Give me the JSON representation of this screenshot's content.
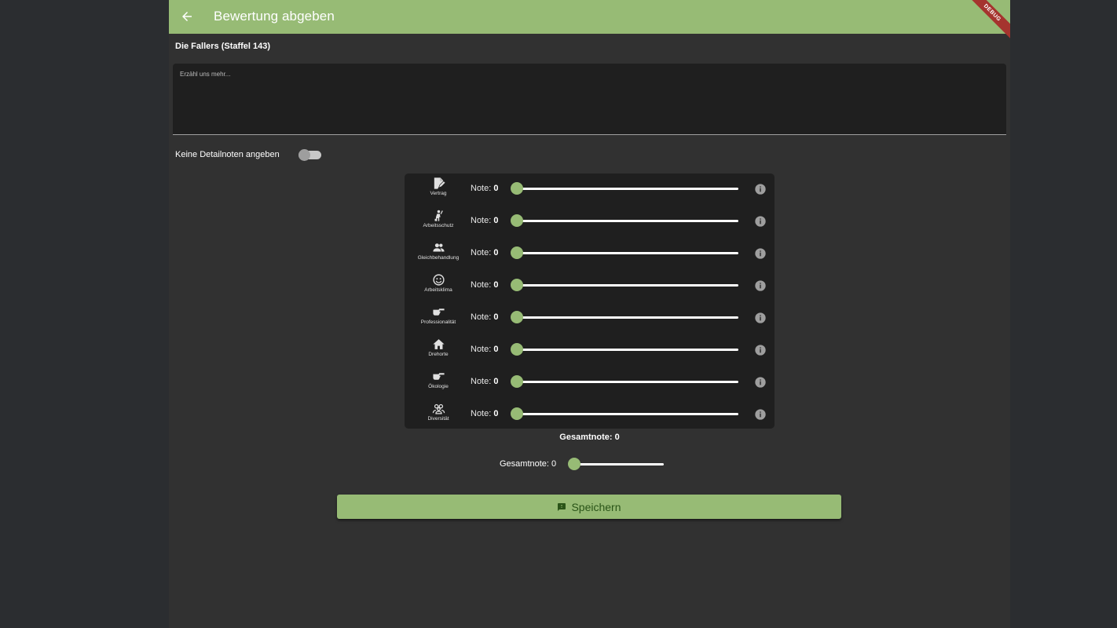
{
  "appbar": {
    "title": "Bewertung abgeben",
    "debug_label": "DEBUG",
    "back_icon": "arrow-back-icon"
  },
  "show_title": "Die Fallers (Staffel 143)",
  "review_input": {
    "placeholder": "Erzähl uns mehr...",
    "value": ""
  },
  "toggle": {
    "label": "Keine Detailnoten angeben",
    "on": false
  },
  "ratings": {
    "note_label": "Note: ",
    "items": [
      {
        "label": "Vertrag",
        "icon": "contract-icon",
        "value": "0"
      },
      {
        "label": "Arbeitsschutz",
        "icon": "worker-icon",
        "value": "0"
      },
      {
        "label": "Gleichbehandlung",
        "icon": "people-icon",
        "value": "0"
      },
      {
        "label": "Arbeitsklima",
        "icon": "smiley-icon",
        "value": "0"
      },
      {
        "label": "Professionalität",
        "icon": "hand-pointing-icon",
        "value": "0"
      },
      {
        "label": "Drehorte",
        "icon": "home-icon",
        "value": "0"
      },
      {
        "label": "Ökologie",
        "icon": "hand-pointing-icon",
        "value": "0"
      },
      {
        "label": "Diversität",
        "icon": "diversity-icon",
        "value": "0"
      }
    ]
  },
  "panel_total": "Gesamtnote: 0",
  "overall": {
    "label": "Gesamtnote: 0",
    "value": 0
  },
  "save_button": {
    "label": "Speichern",
    "icon": "feedback-icon"
  },
  "colors": {
    "accent": "#97bb75",
    "background": "#313131",
    "panel": "#1f1f1f"
  }
}
